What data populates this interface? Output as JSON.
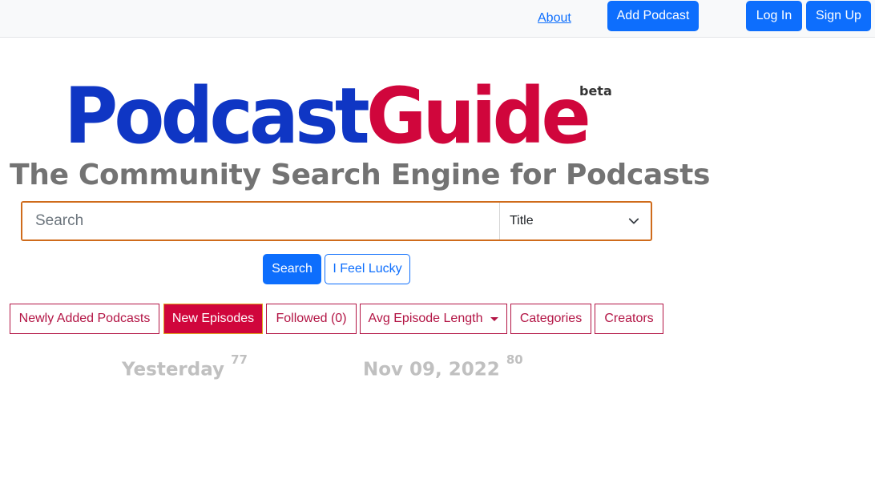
{
  "header": {
    "about_label": "About",
    "add_podcast_label": "Add Podcast",
    "log_in_label": "Log In",
    "sign_up_label": "Sign Up"
  },
  "branding": {
    "logo_part1": "Podcast",
    "logo_part2": "Guide",
    "logo_colors": {
      "part1": "#0f36c4",
      "part2": "#d0063c"
    },
    "beta_label": "beta",
    "tagline": "The Community Search Engine for Podcasts"
  },
  "search": {
    "placeholder": "Search",
    "value": "",
    "field_selected": "Title",
    "search_button_label": "Search",
    "lucky_button_label": "I Feel Lucky"
  },
  "tabs": [
    {
      "label": "Newly Added Podcasts",
      "active": false
    },
    {
      "label": "New Episodes",
      "active": true
    },
    {
      "label": "Followed (0)",
      "active": false
    },
    {
      "label": "Avg Episode Length",
      "active": false,
      "dropdown": true
    },
    {
      "label": "Categories",
      "active": false
    },
    {
      "label": "Creators",
      "active": false
    }
  ],
  "date_groups": [
    {
      "label": "Yesterday",
      "count": "77"
    },
    {
      "label": "Nov 09, 2022",
      "count": "80"
    }
  ],
  "colors": {
    "primary": "#0d6efd",
    "accent_red": "#d0063c",
    "tab_border": "#b31545"
  }
}
